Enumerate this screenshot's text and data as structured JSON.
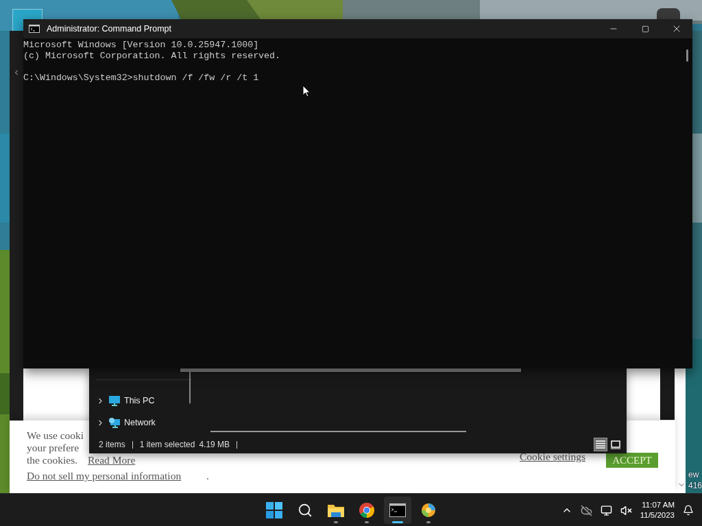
{
  "desktop": {
    "icon_labels": [
      "ew",
      "416"
    ]
  },
  "browser": {
    "cookie_banner": {
      "lines": [
        "We use cooki",
        "your prefere",
        "the cookies."
      ],
      "read_more": "Read More",
      "do_not_sell": "Do not sell my personal information",
      "period": ".",
      "settings_link": "Cookie settings",
      "accept_button": "ACCEPT"
    }
  },
  "explorer": {
    "nav_items": [
      {
        "label": "This PC",
        "kind": "pc",
        "expanded": false
      },
      {
        "label": "Network",
        "kind": "network",
        "expanded": false
      }
    ],
    "status_bar": [
      "2 items",
      "1 item selected",
      "4.19 MB"
    ],
    "views": [
      {
        "kind": "details",
        "selected": true
      },
      {
        "kind": "tiles",
        "selected": false
      }
    ]
  },
  "console": {
    "window": {
      "title": "Administrator: Command Prompt"
    },
    "lines": [
      "Microsoft Windows [Version 10.0.25947.1000]",
      "(c) Microsoft Corporation. All rights reserved."
    ],
    "command_line": "C:\\Windows\\System32>shutdown /f /fw /r /t 1"
  },
  "taskbar": {
    "apps": [
      {
        "kind": "start",
        "running": false,
        "selected": false
      },
      {
        "kind": "search",
        "running": false,
        "selected": false
      },
      {
        "kind": "explorer",
        "running": true,
        "selected": false
      },
      {
        "kind": "chrome",
        "running": true,
        "selected": false
      },
      {
        "kind": "terminal",
        "running": true,
        "selected": true
      },
      {
        "kind": "photos",
        "running": true,
        "selected": false
      }
    ],
    "time": "11:07 AM",
    "date": "11/5/2023"
  }
}
